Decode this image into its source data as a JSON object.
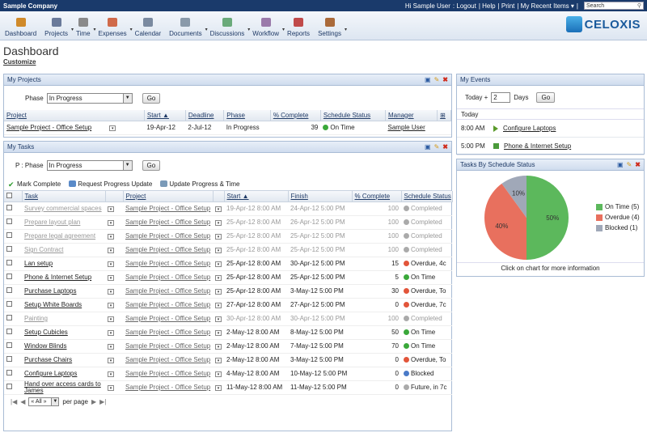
{
  "topbar": {
    "company": "Sample Company",
    "greeting": "Hi Sample User",
    "links": [
      ": Logout",
      "| Help",
      "| Print",
      "| My Recent Items ▾",
      "|"
    ],
    "search_placeholder": "Search"
  },
  "toolbar": {
    "items": [
      {
        "label": "Dashboard",
        "icon": "home-icon",
        "color": "#d08a2a",
        "arrow": ""
      },
      {
        "label": "Projects",
        "icon": "projects-icon",
        "color": "#6a7a9a",
        "arrow": "▾"
      },
      {
        "label": "Time",
        "icon": "clock-icon",
        "color": "#8a8a8a",
        "arrow": "▾"
      },
      {
        "label": "Expenses",
        "icon": "expenses-icon",
        "color": "#d06a4a",
        "arrow": "▾"
      },
      {
        "label": "Calendar",
        "icon": "calendar-icon",
        "color": "#7a8aa0",
        "arrow": ""
      },
      {
        "label": "Documents",
        "icon": "documents-icon",
        "color": "#8a9aaa",
        "arrow": "▾"
      },
      {
        "label": "Discussions",
        "icon": "discussions-icon",
        "color": "#6aaa7a",
        "arrow": "▾"
      },
      {
        "label": "Workflow",
        "icon": "workflow-icon",
        "color": "#9a7aaa",
        "arrow": "▾"
      },
      {
        "label": "Reports",
        "icon": "reports-icon",
        "color": "#c04a4a",
        "arrow": ""
      },
      {
        "label": "Settings",
        "icon": "settings-icon",
        "color": "#aa6a3a",
        "arrow": "▾"
      }
    ],
    "logo": "CELOXIS"
  },
  "page": {
    "title": "Dashboard",
    "customize": "Customize"
  },
  "projects": {
    "title": "My Projects",
    "phase_label": "Phase",
    "phase_value": "In Progress",
    "go": "Go",
    "headers": [
      "Project",
      "Start ▲",
      "Deadline",
      "Phase",
      "% Complete",
      "Schedule Status",
      "Manager"
    ],
    "rows": [
      {
        "project": "Sample Project - Office Setup",
        "start": "19-Apr-12",
        "deadline": "2-Jul-12",
        "phase": "In Progress",
        "pct": "39",
        "status": "On Time",
        "status_color": "#3aa83a",
        "manager": "Sample User"
      }
    ]
  },
  "tasks": {
    "title": "My Tasks",
    "phase_label": "P : Phase",
    "phase_value": "In Progress",
    "go": "Go",
    "actions": [
      "Mark Complete",
      "Request Progress Update",
      "Update Progress & Time"
    ],
    "headers": [
      "Task",
      "Project",
      "Start ▲",
      "Finish",
      "% Complete",
      "Schedule Status"
    ],
    "rows": [
      {
        "task": "Survey commercial spaces",
        "project": "Sample Project - Office Setup",
        "start": "19-Apr-12 8:00 AM",
        "finish": "24-Apr-12 5:00 PM",
        "pct": "100",
        "status": "Completed",
        "color": "#aaaaaa",
        "done": true
      },
      {
        "task": "Prepare layout plan",
        "project": "Sample Project - Office Setup",
        "start": "25-Apr-12 8:00 AM",
        "finish": "26-Apr-12 5:00 PM",
        "pct": "100",
        "status": "Completed",
        "color": "#aaaaaa",
        "done": true
      },
      {
        "task": "Prepare legal agreement",
        "project": "Sample Project - Office Setup",
        "start": "25-Apr-12 8:00 AM",
        "finish": "25-Apr-12 5:00 PM",
        "pct": "100",
        "status": "Completed",
        "color": "#aaaaaa",
        "done": true
      },
      {
        "task": "Sign Contract",
        "project": "Sample Project - Office Setup",
        "start": "25-Apr-12 8:00 AM",
        "finish": "25-Apr-12 5:00 PM",
        "pct": "100",
        "status": "Completed",
        "color": "#aaaaaa",
        "done": true
      },
      {
        "task": "Lan setup",
        "project": "Sample Project - Office Setup",
        "start": "25-Apr-12 8:00 AM",
        "finish": "30-Apr-12 5:00 PM",
        "pct": "15",
        "status": "Overdue, 4c",
        "color": "#e2553a",
        "done": false
      },
      {
        "task": "Phone & Internet Setup",
        "project": "Sample Project - Office Setup",
        "start": "25-Apr-12 8:00 AM",
        "finish": "25-Apr-12 5:00 PM",
        "pct": "5",
        "status": "On Time",
        "color": "#3aa83a",
        "done": false
      },
      {
        "task": "Purchase Laptops",
        "project": "Sample Project - Office Setup",
        "start": "25-Apr-12 8:00 AM",
        "finish": "3-May-12 5:00 PM",
        "pct": "30",
        "status": "Overdue, To",
        "color": "#e2553a",
        "done": false
      },
      {
        "task": "Setup White Boards",
        "project": "Sample Project - Office Setup",
        "start": "27-Apr-12 8:00 AM",
        "finish": "27-Apr-12 5:00 PM",
        "pct": "0",
        "status": "Overdue, 7c",
        "color": "#e2553a",
        "done": false
      },
      {
        "task": "Painting",
        "project": "Sample Project - Office Setup",
        "start": "30-Apr-12 8:00 AM",
        "finish": "30-Apr-12 5:00 PM",
        "pct": "100",
        "status": "Completed",
        "color": "#aaaaaa",
        "done": true
      },
      {
        "task": "Setup Cubicles",
        "project": "Sample Project - Office Setup",
        "start": "2-May-12 8:00 AM",
        "finish": "8-May-12 5:00 PM",
        "pct": "50",
        "status": "On Time",
        "color": "#3aa83a",
        "done": false
      },
      {
        "task": "Window Blinds",
        "project": "Sample Project - Office Setup",
        "start": "2-May-12 8:00 AM",
        "finish": "7-May-12 5:00 PM",
        "pct": "70",
        "status": "On Time",
        "color": "#3aa83a",
        "done": false
      },
      {
        "task": "Purchase Chairs",
        "project": "Sample Project - Office Setup",
        "start": "2-May-12 8:00 AM",
        "finish": "3-May-12 5:00 PM",
        "pct": "0",
        "status": "Overdue, To",
        "color": "#e2553a",
        "done": false
      },
      {
        "task": "Configure Laptops",
        "project": "Sample Project - Office Setup",
        "start": "4-May-12 8:00 AM",
        "finish": "10-May-12 5:00 PM",
        "pct": "0",
        "status": "Blocked",
        "color": "#4a7ac8",
        "done": false
      },
      {
        "task": "Hand over access cards to James",
        "project": "Sample Project - Office Setup",
        "start": "11-May-12 8:00 AM",
        "finish": "11-May-12 5:00 PM",
        "pct": "0",
        "status": "Future, in 7c",
        "color": "#aaaaaa",
        "done": false
      }
    ],
    "pager": {
      "all": "« All »",
      "per_page": "per page"
    }
  },
  "events": {
    "title": "My Events",
    "today_label": "Today +",
    "days_value": "2",
    "days_label": "Days",
    "go": "Go",
    "section": "Today",
    "items": [
      {
        "time": "8:00 AM",
        "label": "Configure Laptops",
        "kind": "task"
      },
      {
        "time": "5:00 PM",
        "label": "Phone & Internet Setup",
        "kind": "milestone"
      }
    ]
  },
  "status_chart": {
    "title": "Tasks By Schedule Status",
    "footer": "Click on chart for more information",
    "chart_data": {
      "type": "pie",
      "categories": [
        "On Time (5)",
        "Overdue (4)",
        "Blocked (1)"
      ],
      "values": [
        5,
        4,
        1
      ],
      "labels": [
        "50%",
        "40%",
        "10%"
      ],
      "colors": [
        "#5cb85c",
        "#e8705e",
        "#a0a8b8"
      ],
      "legend": "right"
    }
  }
}
